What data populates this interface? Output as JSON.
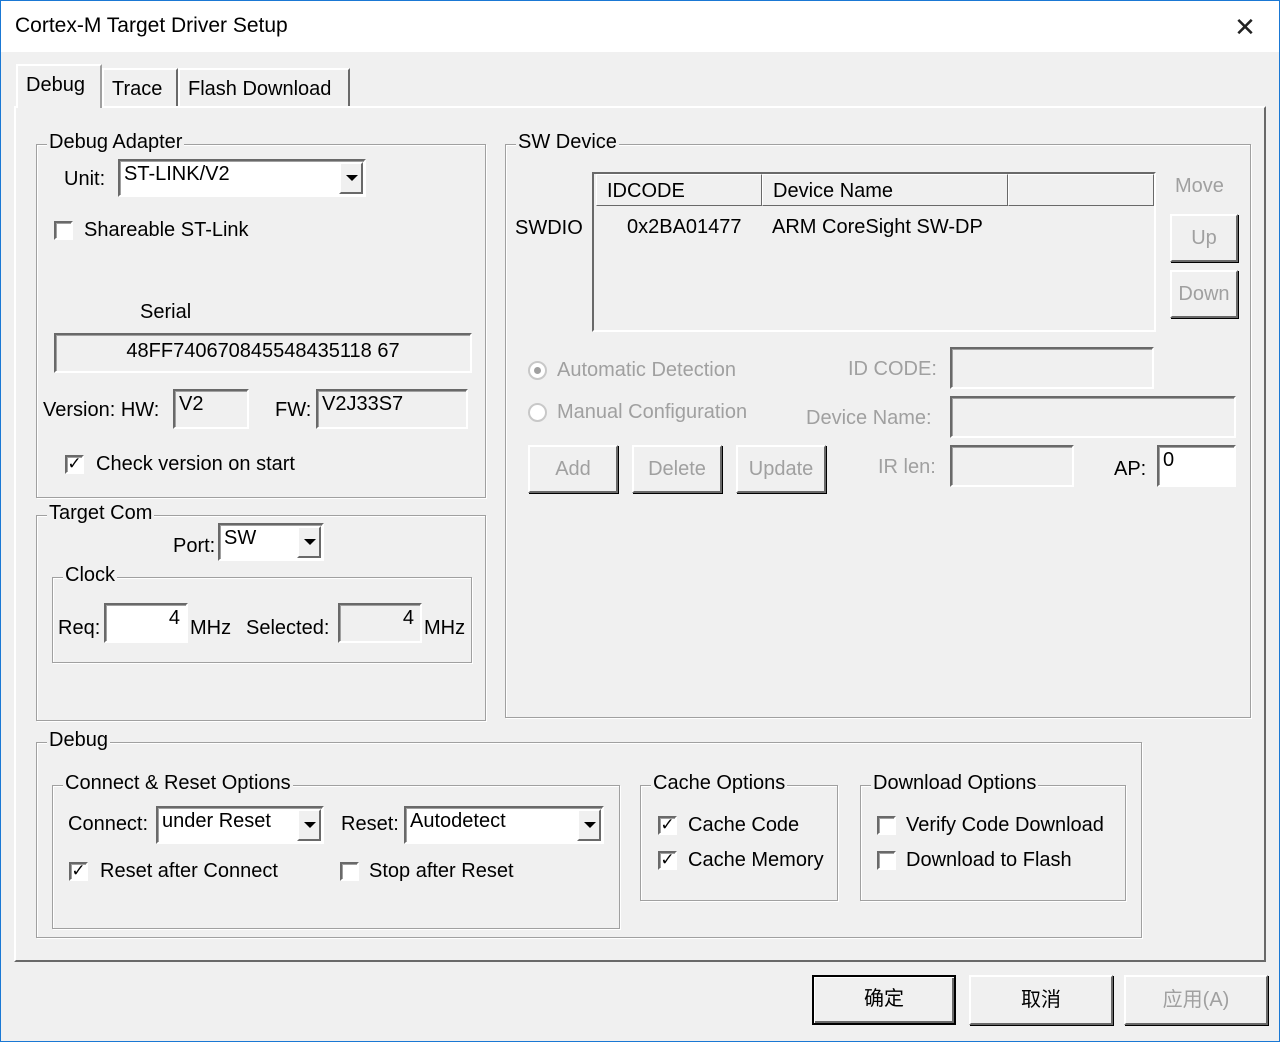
{
  "window": {
    "title": "Cortex-M Target Driver Setup"
  },
  "tabs": [
    "Debug",
    "Trace",
    "Flash Download"
  ],
  "debug_adapter": {
    "title": "Debug Adapter",
    "unit_label": "Unit:",
    "unit_value": "ST-LINK/V2",
    "shareable_label": "Shareable ST-Link",
    "shareable_checked": false,
    "serial_label": "Serial",
    "serial_value": "48FF740670845548435118 67",
    "version_label": "Version: HW:",
    "hw_value": "V2",
    "fw_label": "FW:",
    "fw_value": "V2J33S7",
    "check_version_label": "Check version on start",
    "check_version_checked": true
  },
  "target_com": {
    "title": "Target Com",
    "port_label": "Port:",
    "port_value": "SW",
    "clock_title": "Clock",
    "req_label": "Req:",
    "req_value": "4",
    "req_unit": "MHz",
    "selected_label": "Selected:",
    "selected_value": "4",
    "selected_unit": "MHz"
  },
  "sw_device": {
    "title": "SW Device",
    "row_label": "SWDIO",
    "columns": [
      "IDCODE",
      "Device Name"
    ],
    "rows": [
      {
        "idcode": "0x2BA01477",
        "device_name": "ARM CoreSight SW-DP"
      }
    ],
    "move_label": "Move",
    "up_label": "Up",
    "down_label": "Down",
    "auto_detect_label": "Automatic Detection",
    "manual_config_label": "Manual Configuration",
    "id_code_label": "ID CODE:",
    "device_name_label": "Device Name:",
    "add_label": "Add",
    "delete_label": "Delete",
    "update_label": "Update",
    "ir_len_label": "IR len:",
    "ap_label": "AP:",
    "ap_value": "0"
  },
  "debug": {
    "title": "Debug",
    "connect_reset": {
      "title": "Connect & Reset Options",
      "connect_label": "Connect:",
      "connect_value": "under Reset",
      "reset_label": "Reset:",
      "reset_value": "Autodetect",
      "reset_after_connect_label": "Reset after Connect",
      "reset_after_connect_checked": true,
      "stop_after_reset_label": "Stop after Reset",
      "stop_after_reset_checked": false
    },
    "cache": {
      "title": "Cache Options",
      "cache_code_label": "Cache Code",
      "cache_memory_label": "Cache Memory"
    },
    "download": {
      "title": "Download Options",
      "verify_label": "Verify Code Download",
      "download_flash_label": "Download to Flash"
    }
  },
  "buttons": {
    "ok": "确定",
    "cancel": "取消",
    "apply": "应用(A)"
  },
  "icons": {
    "close": "close-icon",
    "check": "check-icon",
    "dropdown": "chevron-down-icon"
  }
}
